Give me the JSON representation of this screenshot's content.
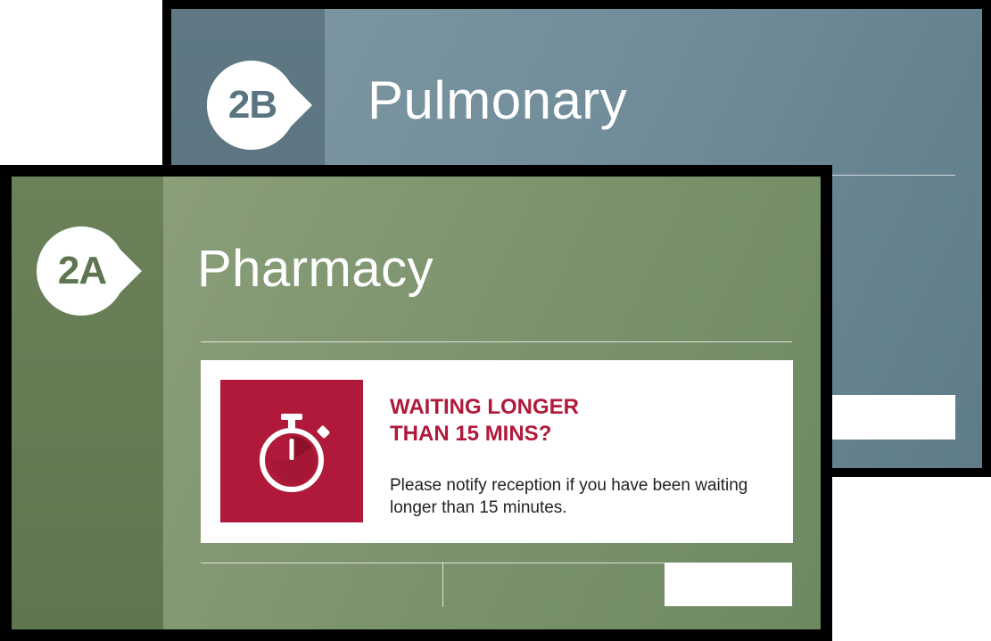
{
  "back_screen": {
    "badge": "2B",
    "title": "Pulmonary"
  },
  "front_screen": {
    "badge": "2A",
    "title": "Pharmacy",
    "notice": {
      "icon": "stopwatch-icon",
      "headline_line1": "WAITING LONGER",
      "headline_line2": "THAN 15 MINS?",
      "body": "Please notify reception if you have been waiting longer than 15 minutes."
    }
  },
  "colors": {
    "pulmonary_bg": "#728e9a",
    "pharmacy_bg": "#7f9670",
    "alert_red": "#b0193a",
    "white": "#ffffff"
  }
}
